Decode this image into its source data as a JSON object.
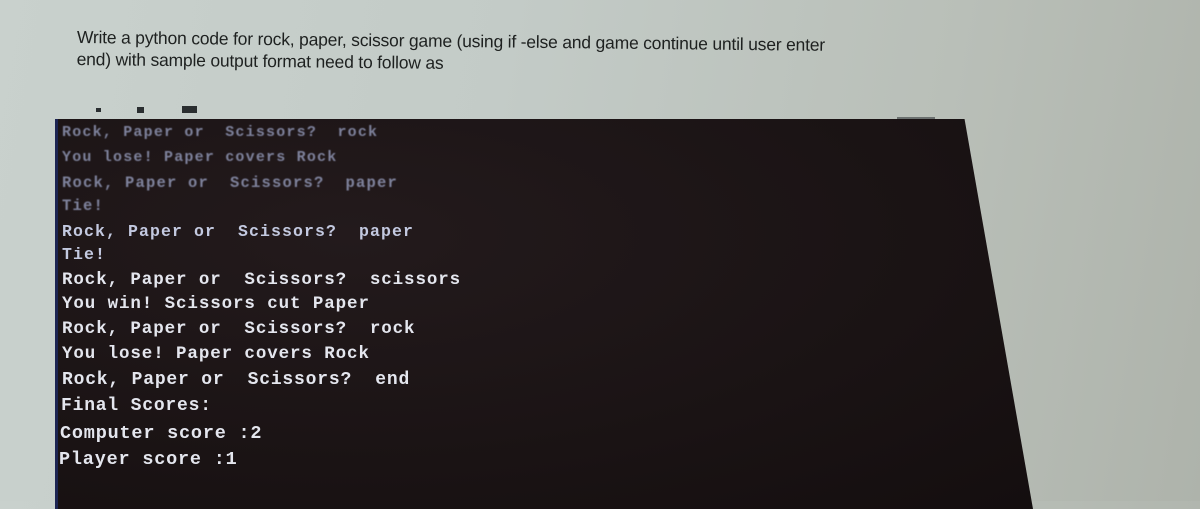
{
  "question": {
    "line1": "Write a python code for rock, paper, scissor game (using if -else and game continue until user enter",
    "line2": "end) with sample output format need to follow as"
  },
  "terminal": {
    "background_color": "#1a1314",
    "text_color": "#e4e6ee",
    "lines": [
      "Rock, Paper or  Scissors?  rock",
      "You lose! Paper covers Rock",
      "Rock, Paper or  Scissors?  paper",
      "Tie!",
      "Rock, Paper or  Scissors?  paper",
      "Tie!",
      "Rock, Paper or  Scissors?  scissors",
      "You win! Scissors cut Paper",
      "Rock, Paper or  Scissors?  rock",
      "You lose! Paper covers Rock",
      "Rock, Paper or  Scissors?  end",
      "Final Scores:",
      "Computer score :2",
      "Player score :1"
    ]
  },
  "icons": [
    "toolbar-dot-icon",
    "toolbar-square-icon",
    "toolbar-arrow-icon"
  ]
}
